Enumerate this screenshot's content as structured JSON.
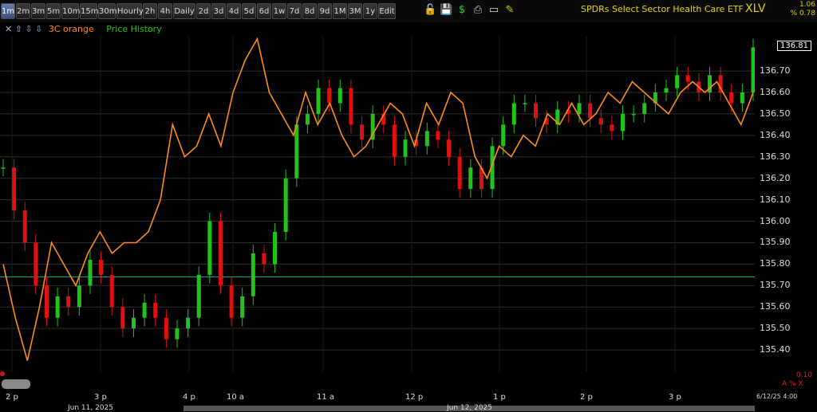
{
  "toolbar": {
    "timeframes": [
      "1m",
      "2m",
      "3m",
      "5m",
      "10m",
      "15m",
      "30m",
      "Hourly",
      "2h",
      "4h",
      "Daily",
      "2d",
      "3d",
      "4d",
      "5d",
      "6d",
      "1w",
      "7d",
      "8d",
      "9d",
      "1M",
      "3M",
      "1y",
      "Edit"
    ],
    "active": "1m",
    "icons": [
      "lock-icon",
      "save-icon",
      "dollar-icon",
      "print-icon",
      "window-icon",
      "pencil-icon"
    ],
    "symbol_description": "SPDRs Select Sector Health Care ETF",
    "symbol": "XLV",
    "change": "1.06",
    "change_pct": "% 0.78"
  },
  "legend": {
    "arrows": "✕ ⇧ ⇩ ⇩",
    "series_a": "3C orange",
    "series_b": "Price History"
  },
  "colors": {
    "orange": "#ff8c1a",
    "up": "#22c31b",
    "down": "#e01010",
    "grid": "#2e2e2e",
    "hline": "#0fa8a0"
  },
  "indicator": {
    "lower_value": "0.10",
    "lower_label": "A % X"
  },
  "chart_data": {
    "type": "line",
    "title": "SPDRs Select Sector Health Care ETF",
    "y_ticks": [
      136.7,
      136.6,
      136.5,
      136.4,
      136.3,
      136.2,
      136.1,
      136.0,
      135.9,
      135.8,
      135.7,
      135.6,
      135.5,
      135.4
    ],
    "ylim": [
      135.3,
      136.86
    ],
    "last_price": "136.81",
    "reference_line": 135.74,
    "x_tick_labels": [
      "2 p",
      "3 p",
      "4 p",
      "10 a",
      "11 a",
      "12 p",
      "1 p",
      "2 p",
      "3 p"
    ],
    "date_labels": [
      "Jun 11, 2025",
      "Jun 12, 2025"
    ],
    "end_label": "6/12/25 4:00",
    "series": [
      {
        "name": "Price History",
        "kind": "candles",
        "closes": [
          136.25,
          136.05,
          135.9,
          135.7,
          135.55,
          135.65,
          135.6,
          135.7,
          135.82,
          135.75,
          135.6,
          135.5,
          135.55,
          135.62,
          135.55,
          135.45,
          135.5,
          135.55,
          135.75,
          136.0,
          135.7,
          135.55,
          135.65,
          135.85,
          135.8,
          135.95,
          136.2,
          136.45,
          136.5,
          136.62,
          136.55,
          136.62,
          136.45,
          136.38,
          136.5,
          136.45,
          136.3,
          136.38,
          136.35,
          136.42,
          136.38,
          136.3,
          136.15,
          136.25,
          136.15,
          136.35,
          136.45,
          136.55,
          136.55,
          136.48,
          136.45,
          136.52,
          136.5,
          136.55,
          136.48,
          136.45,
          136.42,
          136.5,
          136.5,
          136.55,
          136.6,
          136.62,
          136.68,
          136.65,
          136.6,
          136.68,
          136.6,
          136.55,
          136.6,
          136.81
        ]
      },
      {
        "name": "3C orange",
        "kind": "line",
        "values": [
          135.8,
          135.55,
          135.35,
          135.6,
          135.9,
          135.8,
          135.7,
          135.85,
          135.95,
          135.85,
          135.9,
          135.9,
          135.95,
          136.1,
          136.45,
          136.3,
          136.35,
          136.5,
          136.35,
          136.6,
          136.75,
          136.85,
          136.6,
          136.5,
          136.4,
          136.6,
          136.45,
          136.55,
          136.4,
          136.3,
          136.35,
          136.45,
          136.55,
          136.5,
          136.35,
          136.55,
          136.45,
          136.6,
          136.55,
          136.3,
          136.2,
          136.35,
          136.3,
          136.4,
          136.35,
          136.5,
          136.45,
          136.55,
          136.45,
          136.5,
          136.6,
          136.55,
          136.65,
          136.6,
          136.55,
          136.5,
          136.6,
          136.65,
          136.6,
          136.65,
          136.55,
          136.45,
          136.6
        ]
      }
    ]
  }
}
